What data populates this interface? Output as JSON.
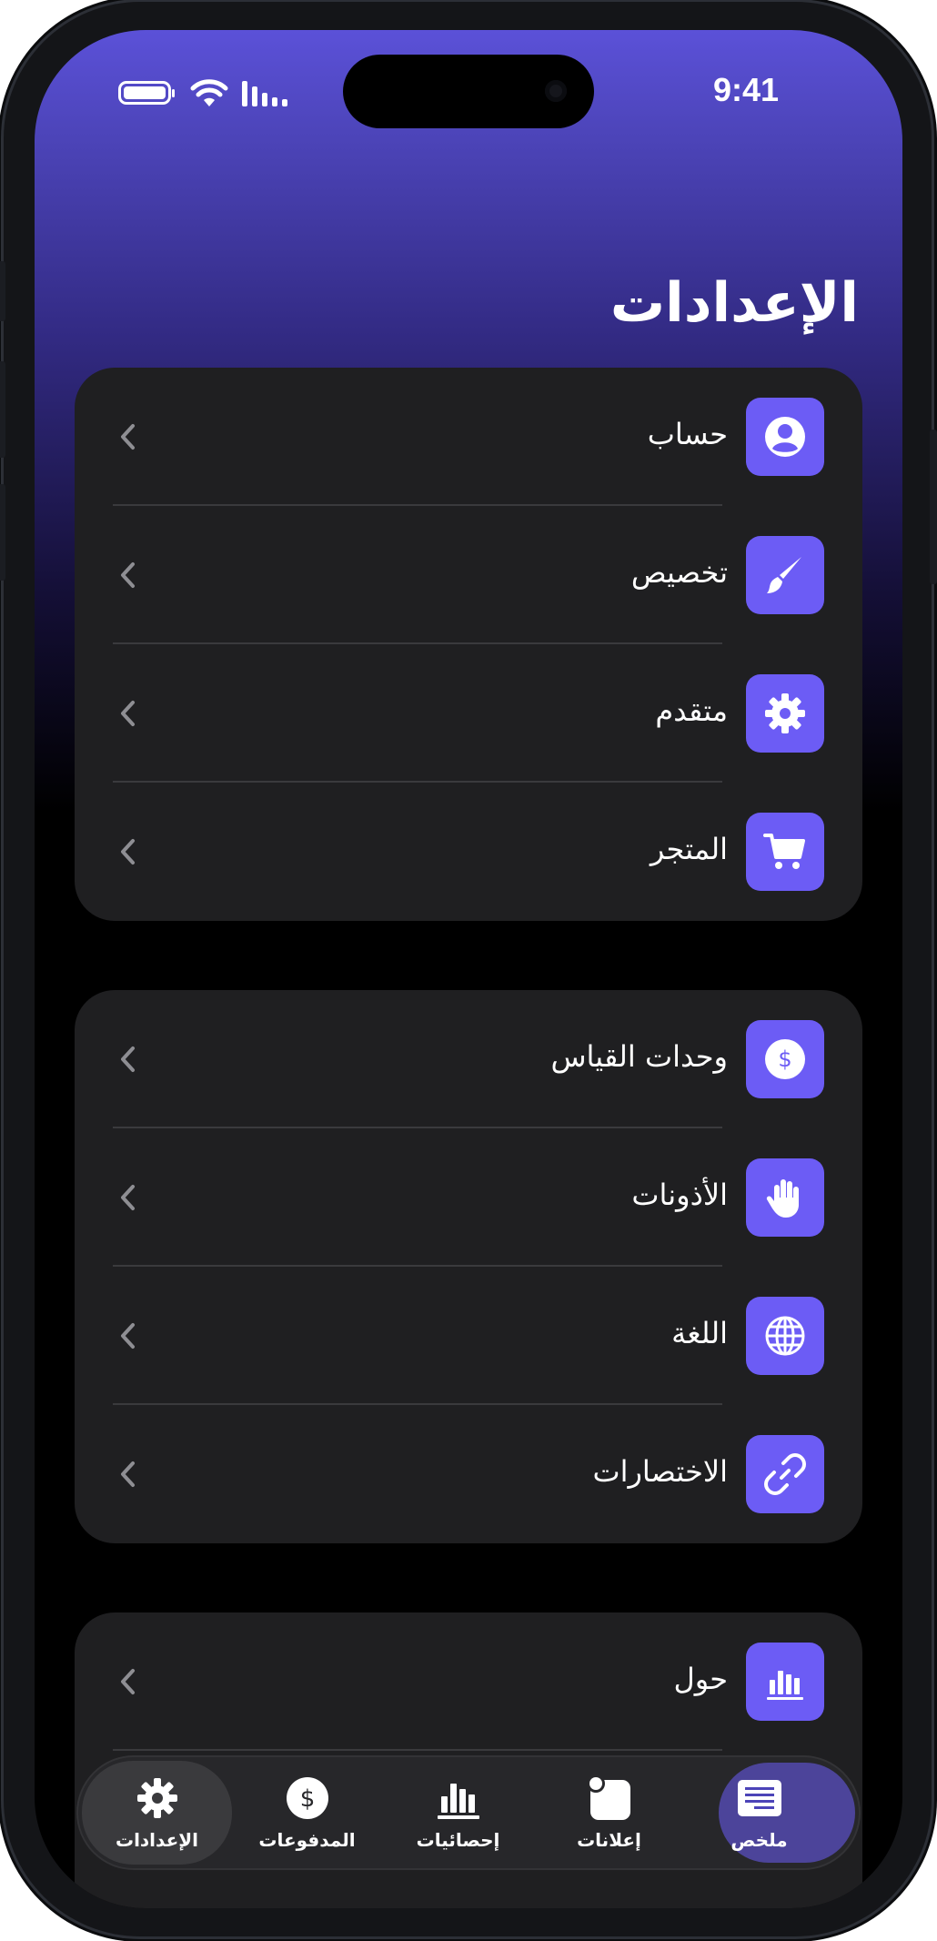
{
  "status_bar": {
    "time": "9:41"
  },
  "header": {
    "title": "الإعدادات"
  },
  "groups": [
    {
      "items": [
        {
          "label": "حساب",
          "icon": "account-icon"
        },
        {
          "label": "تخصيص",
          "icon": "brush-icon"
        },
        {
          "label": "متقدم",
          "icon": "gear-icon"
        },
        {
          "label": "المتجر",
          "icon": "cart-icon"
        }
      ]
    },
    {
      "items": [
        {
          "label": "وحدات القياس",
          "icon": "dollar-icon"
        },
        {
          "label": "الأذونات",
          "icon": "hand-icon"
        },
        {
          "label": "اللغة",
          "icon": "globe-icon"
        },
        {
          "label": "الاختصارات",
          "icon": "link-icon"
        }
      ]
    },
    {
      "items": [
        {
          "label": "حول",
          "icon": "chart-icon"
        }
      ]
    }
  ],
  "tab_bar": {
    "tabs": [
      {
        "label": "الإعدادات",
        "icon": "gear-icon",
        "active": true
      },
      {
        "label": "المدفوعات",
        "icon": "dollar-icon",
        "active": false
      },
      {
        "label": "إحصائيات",
        "icon": "bar-chart-icon",
        "active": false
      },
      {
        "label": "إعلانات",
        "icon": "notification-icon",
        "active": false
      },
      {
        "label": "ملخص",
        "icon": "summary-icon",
        "active": false
      }
    ]
  },
  "colors": {
    "accent": "#6c5cf5",
    "card_bg": "#1f1f21",
    "gradient_top": "#5b51d8",
    "background": "#000000"
  }
}
